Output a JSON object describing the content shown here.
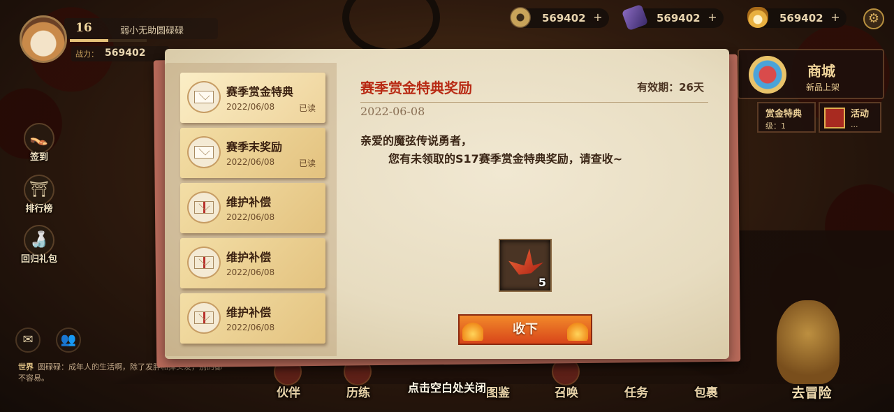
{
  "player": {
    "level": "16",
    "name": "弱小无助圆碌碌",
    "power_label": "战力：",
    "power_value": "569402",
    "exp_fraction": 0.5
  },
  "currencies": [
    {
      "icon": "coin-icon",
      "value": "569402",
      "color": "#c9a45a"
    },
    {
      "icon": "purple-gem-icon",
      "value": "569402",
      "color": "#6a4a9a"
    },
    {
      "icon": "fox-mask-icon",
      "value": "569402",
      "color": "#e8b040"
    }
  ],
  "side_buttons": [
    {
      "label": "签到",
      "icon": "sandals-icon",
      "glyph": "👡"
    },
    {
      "label": "排行榜",
      "icon": "torii-gate-icon",
      "glyph": "⛩"
    },
    {
      "label": "回归礼包",
      "icon": "sake-bottle-icon",
      "glyph": "🍶"
    }
  ],
  "chat": {
    "channel": "世界",
    "message": "圆碌碌：成年人的生活啊，除了发胖和掉头发，别的都不容易。"
  },
  "shop": {
    "title": "商城",
    "subtitle": "新品上架"
  },
  "mini_panels": [
    {
      "title": "赏金特典",
      "sub": "级：1"
    },
    {
      "title": "活动",
      "sub": "..."
    }
  ],
  "mail_list": [
    {
      "title": "赛季赏金特典",
      "date": "2022/06/08",
      "status": "已读",
      "active": true
    },
    {
      "title": "赛季末奖励",
      "date": "2022/06/08",
      "status": "已读",
      "active": false
    },
    {
      "title": "维护补偿",
      "date": "2022/06/08",
      "status": "",
      "active": false
    },
    {
      "title": "维护补偿",
      "date": "2022/06/08",
      "status": "",
      "active": false
    },
    {
      "title": "维护补偿",
      "date": "2022/06/08",
      "status": "",
      "active": false
    }
  ],
  "mail_detail": {
    "title": "赛季赏金特典奖励",
    "validity": "有效期：26天",
    "date": "2022-06-08",
    "greeting": "亲爱的魔弦传说勇者，",
    "body": "您有未领取的S17赛季赏金特典奖励，请查收~",
    "reward": {
      "icon": "paper-crane-icon",
      "count": "5"
    },
    "claim_label": "收下"
  },
  "close_hint": "点击空白处关闭",
  "bottom_nav": [
    {
      "label": "伙伴"
    },
    {
      "label": "历练"
    },
    {
      "label": "图鉴"
    },
    {
      "label": "召唤"
    },
    {
      "label": "任务"
    },
    {
      "label": "包裹"
    }
  ],
  "adventure_label": "去冒险",
  "colors": {
    "accent_red": "#b82a14",
    "paper": "#efe4cc",
    "button_orange": "#e8602a"
  }
}
